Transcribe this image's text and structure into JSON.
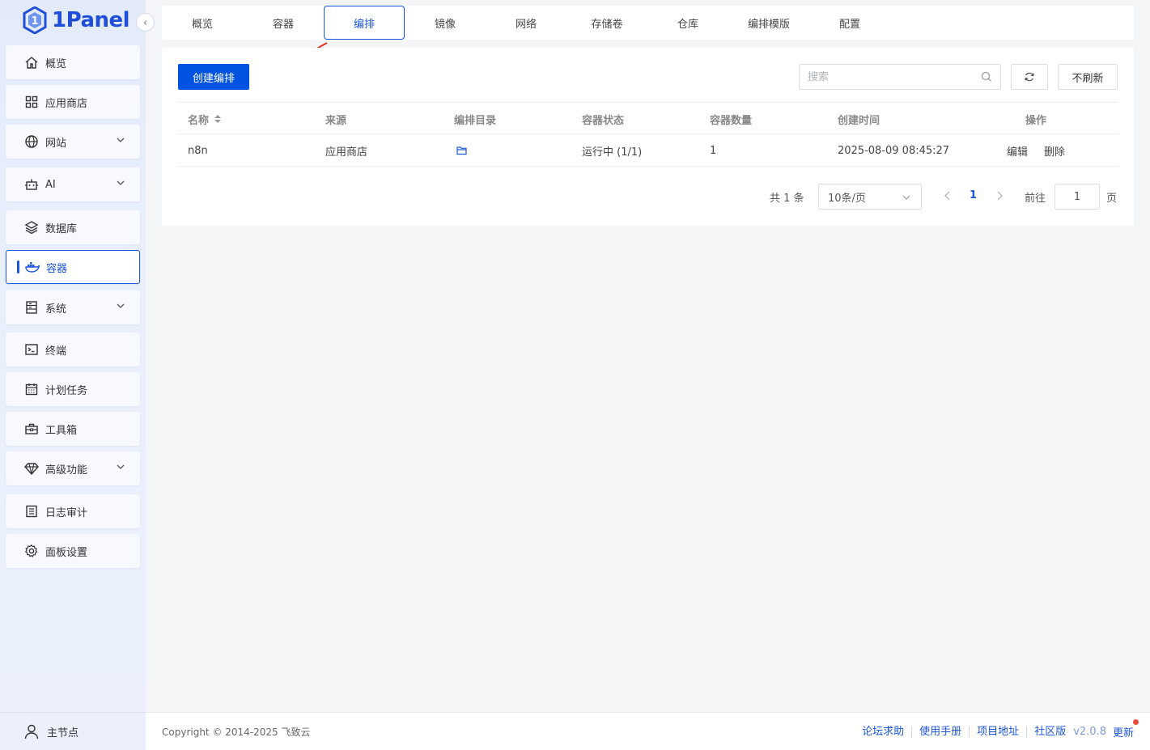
{
  "brand": {
    "name": "1Panel"
  },
  "sidebar": {
    "items": [
      {
        "label": "概览",
        "icon": "home-icon",
        "expandable": false
      },
      {
        "label": "应用商店",
        "icon": "grid-icon",
        "expandable": false
      },
      {
        "label": "网站",
        "icon": "globe-icon",
        "expandable": true
      },
      {
        "label": "AI",
        "icon": "robot-icon",
        "expandable": true
      },
      {
        "label": "数据库",
        "icon": "layers-icon",
        "expandable": false
      },
      {
        "label": "容器",
        "icon": "docker-icon",
        "expandable": false,
        "active": true
      },
      {
        "label": "系统",
        "icon": "server-icon",
        "expandable": true
      },
      {
        "label": "终端",
        "icon": "terminal-icon",
        "expandable": false
      },
      {
        "label": "计划任务",
        "icon": "calendar-icon",
        "expandable": false
      },
      {
        "label": "工具箱",
        "icon": "toolbox-icon",
        "expandable": false
      },
      {
        "label": "高级功能",
        "icon": "diamond-icon",
        "expandable": true
      },
      {
        "label": "日志审计",
        "icon": "log-icon",
        "expandable": false
      },
      {
        "label": "面板设置",
        "icon": "gear-icon",
        "expandable": false
      }
    ],
    "node_label": "主节点"
  },
  "tabs": [
    {
      "label": "概览"
    },
    {
      "label": "容器"
    },
    {
      "label": "编排",
      "active": true
    },
    {
      "label": "镜像"
    },
    {
      "label": "网络"
    },
    {
      "label": "存储卷"
    },
    {
      "label": "仓库"
    },
    {
      "label": "编排模版"
    },
    {
      "label": "配置"
    }
  ],
  "toolbar": {
    "create_label": "创建编排",
    "search_placeholder": "搜索",
    "refresh_label": "不刷新"
  },
  "table": {
    "columns": [
      "名称",
      "来源",
      "编排目录",
      "容器状态",
      "容器数量",
      "创建时间",
      "操作"
    ],
    "rows": [
      {
        "name": "n8n",
        "source": "应用商店",
        "status": "运行中 (1/1)",
        "count": "1",
        "created": "2025-08-09 08:45:27",
        "edit": "编辑",
        "delete": "删除"
      }
    ]
  },
  "pagination": {
    "total": "共 1 条",
    "page_size": "10条/页",
    "current": "1",
    "goto_label": "前往",
    "goto_value": "1",
    "page_suffix": "页"
  },
  "footer": {
    "copyright": "Copyright © 2014-2025 飞致云",
    "links": [
      "论坛求助",
      "使用手册",
      "项目地址",
      "社区版"
    ],
    "version": "v2.0.8",
    "update": "更新"
  },
  "colors": {
    "accent": "#1a56db",
    "primary_button": "#0052e0",
    "annotation_arrow": "#e8302a"
  }
}
